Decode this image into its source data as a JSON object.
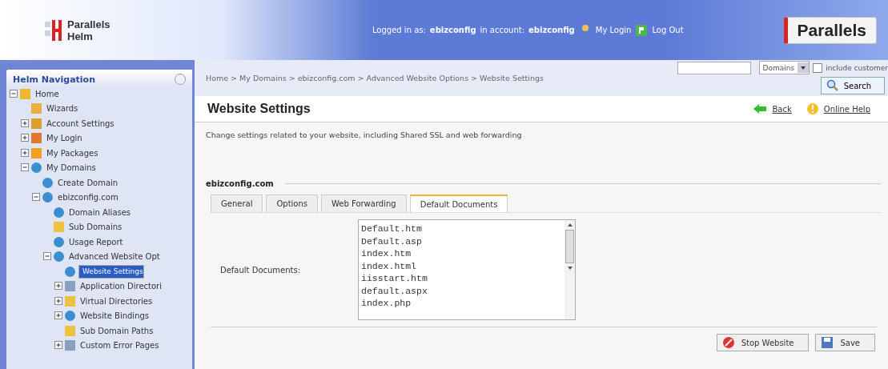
{
  "header": {
    "product": [
      "Parallels",
      "Helm"
    ],
    "login_label": "Logged in as:",
    "login_user": "ebizconfig",
    "account_label": "in account:",
    "account_name": "ebizconfig",
    "links": [
      {
        "kind": "login",
        "label": "My Login"
      },
      {
        "kind": "logout",
        "label": "Log Out"
      }
    ],
    "brand": "Parallels"
  },
  "sidebar": {
    "title": "Helm Navigation",
    "tree": [
      {
        "label": "Home",
        "kind": "home",
        "expanded": true,
        "selected": false,
        "children": [
          {
            "label": "Wizards",
            "kind": "wizard",
            "selected": false
          },
          {
            "label": "Account Settings",
            "kind": "account",
            "expanded": false,
            "selected": false
          },
          {
            "label": "My Login",
            "kind": "user",
            "expanded": false,
            "selected": false
          },
          {
            "label": "My Packages",
            "kind": "package",
            "expanded": false,
            "selected": false
          },
          {
            "label": "My Domains",
            "kind": "globe",
            "expanded": true,
            "selected": false,
            "children": [
              {
                "label": "Create Domain",
                "kind": "globe",
                "selected": false
              },
              {
                "label": "ebizconfig.com",
                "kind": "globe",
                "expanded": true,
                "selected": false,
                "children": [
                  {
                    "label": "Domain Aliases",
                    "kind": "globe",
                    "selected": false
                  },
                  {
                    "label": "Sub Domains",
                    "kind": "folder",
                    "selected": false
                  },
                  {
                    "label": "Usage Report",
                    "kind": "globe",
                    "selected": false
                  },
                  {
                    "label": "Advanced Website Opt",
                    "kind": "globe",
                    "expanded": true,
                    "selected": false,
                    "children": [
                      {
                        "label": "Website Settings",
                        "kind": "globe",
                        "selected": true
                      },
                      {
                        "label": "Application Directori",
                        "kind": "page",
                        "expanded": false,
                        "selected": false
                      },
                      {
                        "label": "Virtual Directories",
                        "kind": "folder",
                        "expanded": false,
                        "selected": false
                      },
                      {
                        "label": "Website Bindings",
                        "kind": "globe",
                        "expanded": false,
                        "selected": false
                      },
                      {
                        "label": "Sub Domain Paths",
                        "kind": "folder",
                        "selected": false
                      },
                      {
                        "label": "Custom Error Pages",
                        "kind": "page",
                        "expanded": false,
                        "selected": false
                      }
                    ]
                  }
                ]
              }
            ]
          }
        ]
      }
    ]
  },
  "breadcrumb": [
    "Home",
    "My Domains",
    "ebizconfig.com",
    "Advanced Website Options",
    "Website Settings"
  ],
  "breadcrumb_separator": ">",
  "search": {
    "select": "Domains",
    "include_checked": false,
    "include_label": "include customer",
    "button": "Search"
  },
  "page": {
    "title": "Website Settings",
    "back": "Back",
    "help": "Online Help",
    "description": "Change settings related to your website, including Shared SSL and web forwarding"
  },
  "section": "ebizconfig.com",
  "tabs": [
    {
      "label": "General",
      "selected": false
    },
    {
      "label": "Options",
      "selected": false
    },
    {
      "label": "Web Forwarding",
      "selected": false
    },
    {
      "label": "Default Documents",
      "selected": true
    }
  ],
  "field": {
    "label": "Default Documents:",
    "value": [
      "Default.htm",
      "Default.asp",
      "index.htm",
      "index.html",
      "iisstart.htm",
      "default.aspx",
      "index.php"
    ]
  },
  "buttons": [
    {
      "kind": "stop",
      "label": "Stop Website"
    },
    {
      "kind": "save",
      "label": "Save"
    }
  ]
}
